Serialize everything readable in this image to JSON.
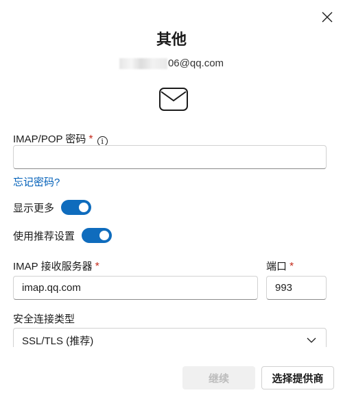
{
  "dialog": {
    "title": "其他",
    "email_visible": "06@qq.com"
  },
  "password": {
    "label": "IMAP/POP 密码",
    "required": "*",
    "info": "i",
    "value": "",
    "forgot_link": "忘记密码?"
  },
  "toggles": [
    {
      "label": "显示更多",
      "on": true
    },
    {
      "label": "使用推荐设置",
      "on": true
    }
  ],
  "imap_server": {
    "label": "IMAP 接收服务器",
    "required": "*",
    "value": "imap.qq.com"
  },
  "port": {
    "label": "端口",
    "required": "*",
    "value": "993"
  },
  "security": {
    "label": "安全连接类型",
    "selected": "SSL/TLS (推荐)"
  },
  "buttons": {
    "continue": "继续",
    "choose_provider": "选择提供商"
  },
  "colors": {
    "accent": "#0f6cbd",
    "link": "#005fb8",
    "required": "#c42b1c"
  }
}
